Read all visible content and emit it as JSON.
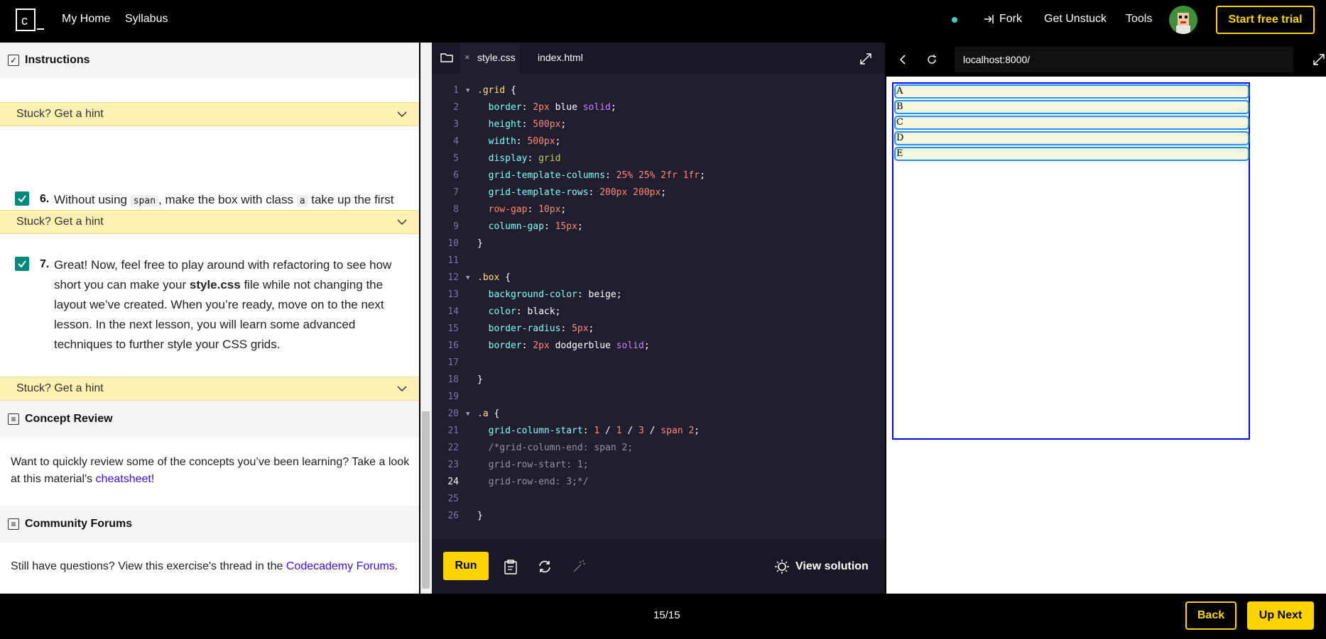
{
  "nav": {
    "home": "My Home",
    "syllabus": "Syllabus",
    "fork": "Fork",
    "unstuck": "Get Unstuck",
    "tools": "Tools",
    "trial": "Start free trial"
  },
  "left": {
    "instructions": "Instructions",
    "hint": "Stuck? Get a hint",
    "task6_num": "6.",
    "task6_a": "Without using ",
    "task6_code1": "span",
    "task6_b": ", make the box with class ",
    "task6_code2": "a",
    "task6_c": " take up the first two rows of the grid.",
    "task7_num": "7.",
    "task7_a": "Great! Now, feel free to play around with refactoring to see how short you can make your ",
    "task7_bold": "style.css",
    "task7_b": " file while not changing the layout we’ve created. When you’re ready, move on to the next lesson. In the next lesson, you will learn some advanced techniques to further style your CSS grids.",
    "concept_title": "Concept Review",
    "concept_text": "Want to quickly review some of the concepts you’ve been learning? Take a look at this material's ",
    "concept_link": "cheatsheet",
    "concept_end": "!",
    "forums_title": "Community Forums",
    "forums_text": "Still have questions? View this exercise's thread in the ",
    "forums_link": "Codecademy Forums",
    "forums_end": "."
  },
  "editor": {
    "tab1": "style.css",
    "tab2": "index.html",
    "run": "Run",
    "view_solution": "View solution",
    "current_line": 24
  },
  "browser": {
    "url": "localhost:8000/",
    "boxes": [
      "A",
      "B",
      "C",
      "D",
      "E"
    ]
  },
  "footer": {
    "progress": "15/15",
    "back": "Back",
    "next": "Up Next"
  },
  "colors": {
    "accent": "#ffd300",
    "check": "#00897b",
    "hint_bg": "#fff0b3",
    "editor_bg": "#211e2f"
  }
}
